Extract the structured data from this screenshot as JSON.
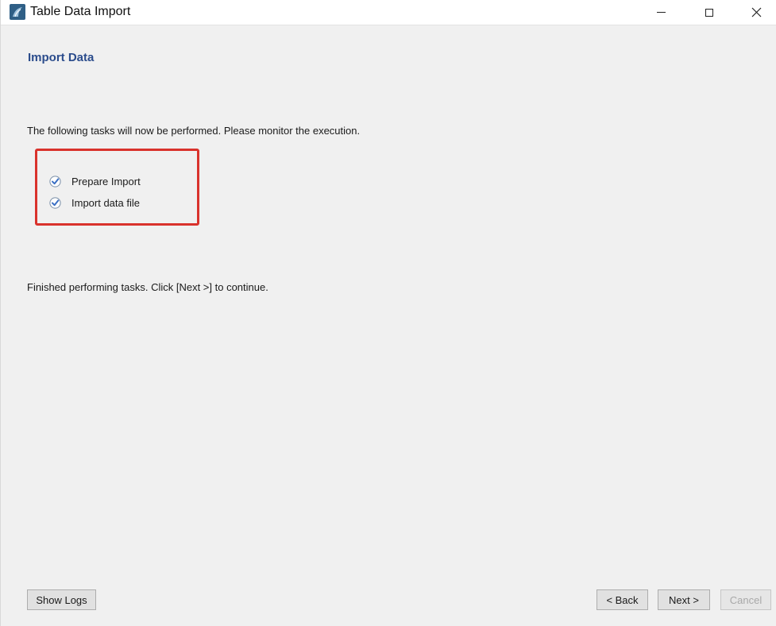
{
  "window": {
    "title": "Table Data Import",
    "icon": "mysql-workbench-dolphin-icon",
    "controls": {
      "minimize": "minimize-icon",
      "maximize": "maximize-icon",
      "close": "close-icon"
    }
  },
  "page": {
    "heading": "Import Data",
    "description": "The following tasks will now be performed. Please monitor the execution.",
    "tasks": [
      {
        "label": "Prepare Import",
        "status": "completed",
        "icon": "check-circle-icon"
      },
      {
        "label": "Import data file",
        "status": "completed",
        "icon": "check-circle-icon"
      }
    ],
    "finished_message": "Finished performing tasks. Click [Next >] to continue."
  },
  "buttons": {
    "show_logs": "Show Logs",
    "back": "< Back",
    "next": "Next >",
    "cancel": "Cancel"
  },
  "colors": {
    "heading": "#2b4c8c",
    "highlight_box": "#d9322c",
    "check": "#3a6fc4"
  }
}
